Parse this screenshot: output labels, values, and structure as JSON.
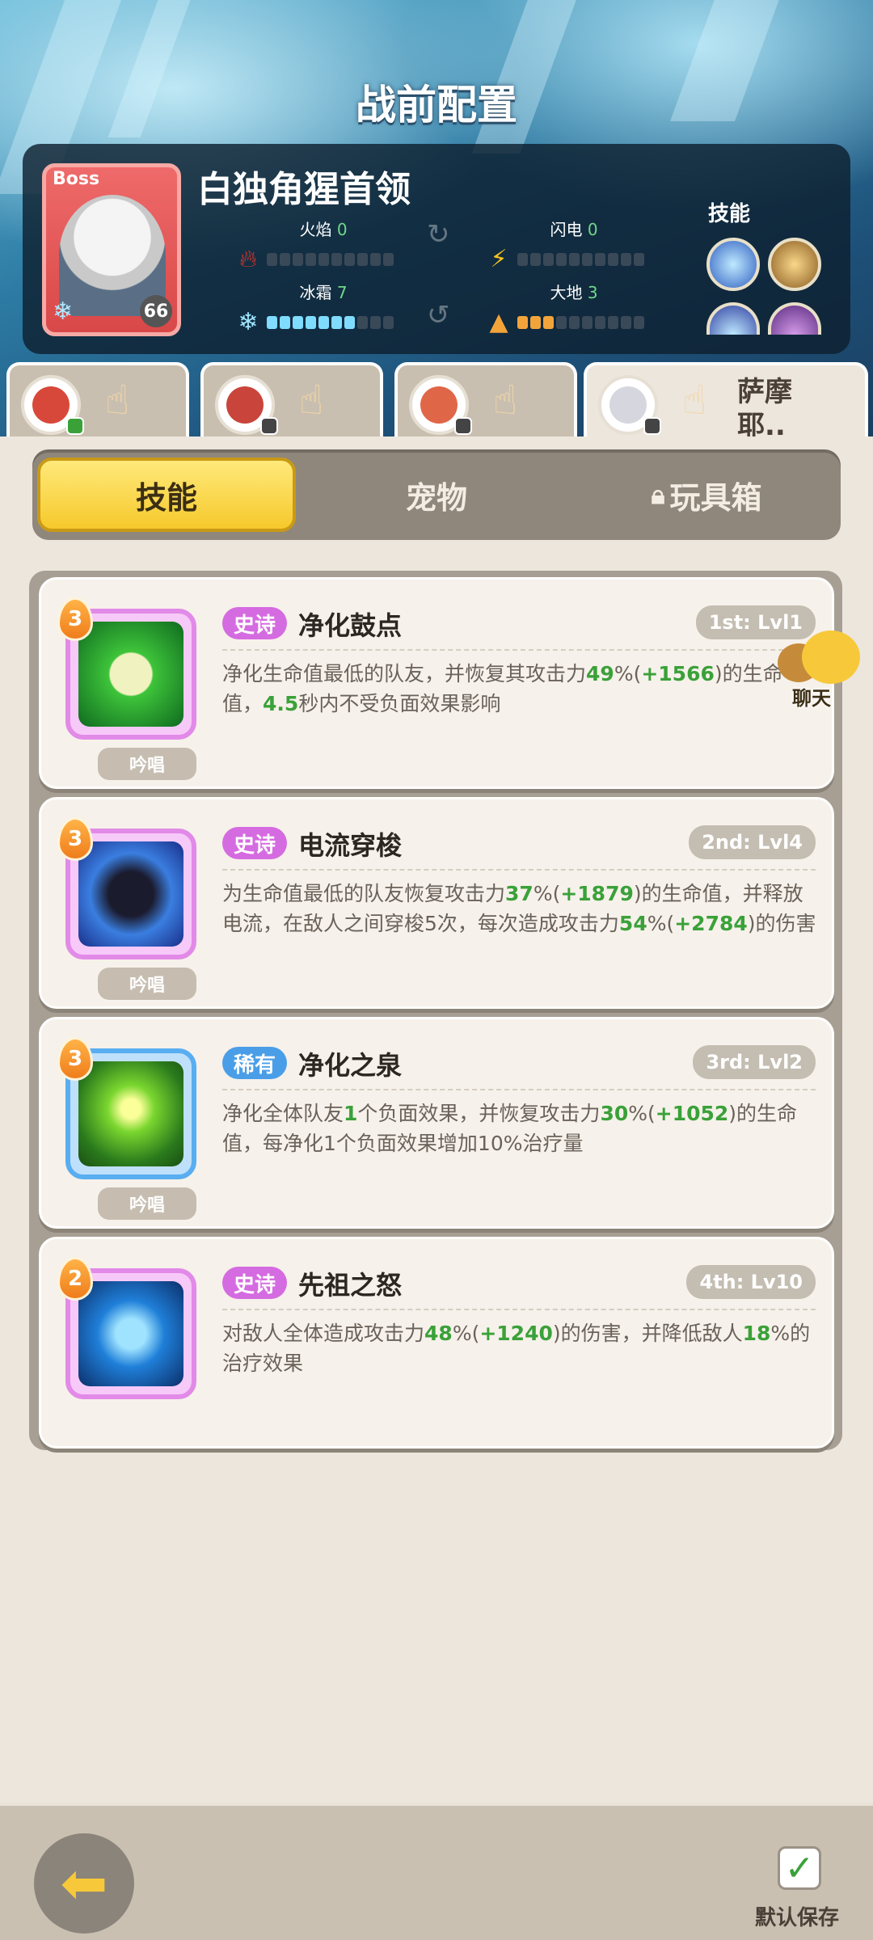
{
  "page": {
    "title": "战前配置"
  },
  "boss": {
    "tag": "Boss",
    "level": "66",
    "name": "白独角猩首领",
    "stats": {
      "fire": {
        "label": "火焰",
        "value": "0",
        "filled": 0
      },
      "lightning": {
        "label": "闪电",
        "value": "0",
        "filled": 0
      },
      "ice": {
        "label": "冰霜",
        "value": "7",
        "filled": 7
      },
      "earth": {
        "label": "大地",
        "value": "3",
        "filled": 3
      }
    },
    "skills_label": "技能"
  },
  "char_tabs": [
    {
      "name": ""
    },
    {
      "name": ""
    },
    {
      "name": ""
    },
    {
      "name": "萨摩耶..",
      "name_line2": "."
    }
  ],
  "segment": {
    "skills": "技能",
    "pets": "宠物",
    "toybox": "玩具箱"
  },
  "skill_cards": [
    {
      "level": "3",
      "rarity": "史诗",
      "rarity_type": "epic",
      "name": "净化鼓点",
      "slot": "1st: Lvl1",
      "chant": "吟唱",
      "desc": [
        {
          "t": "净化生命值最低的队友，并恢复其攻击力",
          "g": false
        },
        {
          "t": "49",
          "g": true
        },
        {
          "t": "%(",
          "g": false
        },
        {
          "t": "+1566",
          "g": true
        },
        {
          "t": ")的生命值，",
          "g": false
        },
        {
          "t": "4.5",
          "g": true
        },
        {
          "t": "秒内不受负面效果影响",
          "g": false
        }
      ]
    },
    {
      "level": "3",
      "rarity": "史诗",
      "rarity_type": "epic",
      "name": "电流穿梭",
      "slot": "2nd: Lvl4",
      "chant": "吟唱",
      "desc": [
        {
          "t": "为生命值最低的队友恢复攻击力",
          "g": false
        },
        {
          "t": "37",
          "g": true
        },
        {
          "t": "%(",
          "g": false
        },
        {
          "t": "+1879",
          "g": true
        },
        {
          "t": ")的生命值，并释放电流，在敌人之间穿梭5次，每次造成攻击力",
          "g": false
        },
        {
          "t": "54",
          "g": true
        },
        {
          "t": "%(",
          "g": false
        },
        {
          "t": "+2784",
          "g": true
        },
        {
          "t": ")的伤害",
          "g": false
        }
      ]
    },
    {
      "level": "3",
      "rarity": "稀有",
      "rarity_type": "rare",
      "name": "净化之泉",
      "slot": "3rd: Lvl2",
      "chant": "吟唱",
      "desc": [
        {
          "t": "净化全体队友",
          "g": false
        },
        {
          "t": "1",
          "g": true
        },
        {
          "t": "个负面效果，并恢复攻击力",
          "g": false
        },
        {
          "t": "30",
          "g": true
        },
        {
          "t": "%(",
          "g": false
        },
        {
          "t": "+1052",
          "g": true
        },
        {
          "t": ")的生命值，每净化1个负面效果增加10%治疗量",
          "g": false
        }
      ]
    },
    {
      "level": "2",
      "rarity": "史诗",
      "rarity_type": "epic",
      "name": "先祖之怒",
      "slot": "4th: Lv10",
      "chant": "",
      "desc": [
        {
          "t": "对敌人全体造成攻击力",
          "g": false
        },
        {
          "t": "48",
          "g": true
        },
        {
          "t": "%(",
          "g": false
        },
        {
          "t": "+1240",
          "g": true
        },
        {
          "t": ")的伤害，并降低敌人",
          "g": false
        },
        {
          "t": "18",
          "g": true
        },
        {
          "t": "%的治疗效果",
          "g": false
        }
      ]
    }
  ],
  "chat": {
    "label": "聊天"
  },
  "footer": {
    "save_label": "默认保存"
  },
  "colors": {
    "accent": "#f6c92c",
    "epic": "#d56be0",
    "rare": "#4a9ee8",
    "green": "#3aa139"
  },
  "icons": [
    "fire-icon",
    "lightning-icon",
    "snowflake-icon",
    "mountain-icon",
    "lock-icon",
    "back-arrow-icon",
    "checkbox-icon",
    "pointing-hand-icon"
  ]
}
